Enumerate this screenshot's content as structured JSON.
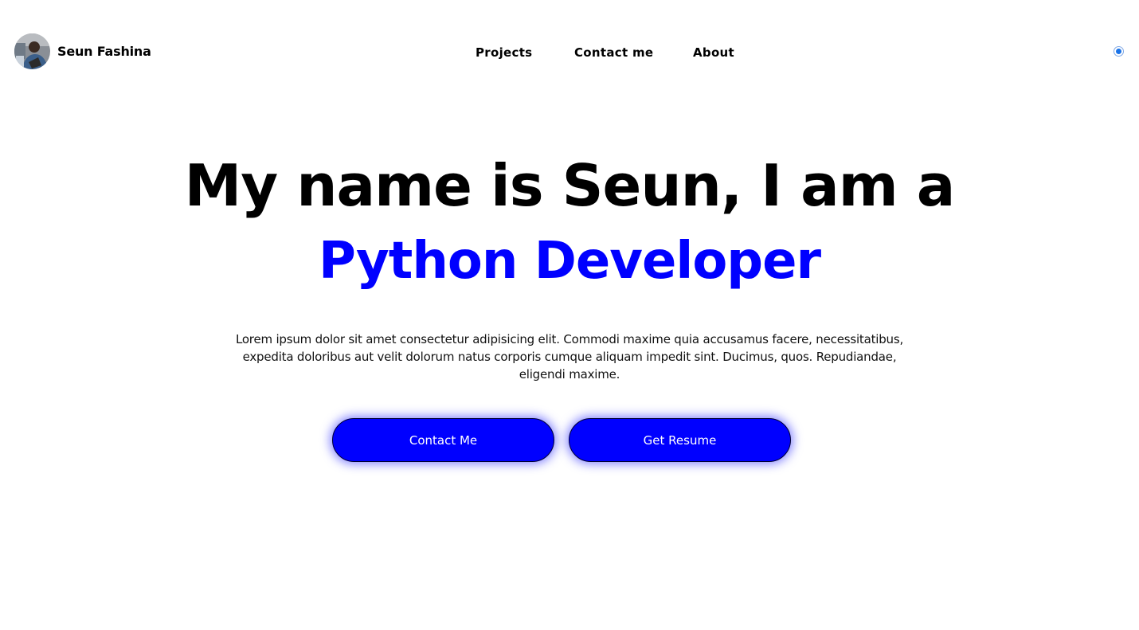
{
  "brand": {
    "name": "Seun Fashina"
  },
  "nav": {
    "items": [
      {
        "label": "Projects"
      },
      {
        "label": "Contact me"
      },
      {
        "label": "About"
      }
    ]
  },
  "hero": {
    "title": "My name is Seun, I am a",
    "subtitle": "Python Developer",
    "description": "Lorem ipsum dolor sit amet consectetur adipisicing elit. Commodi maxime quia accusamus facere, necessitatibus, expedita doloribus aut velit dolorum natus corporis cumque aliquam impedit sint. Ducimus, quos. Repudiandae, eligendi maxime.",
    "buttons": {
      "contact_label": "Contact Me",
      "resume_label": "Get Resume"
    }
  },
  "colors": {
    "accent": "#0000ff",
    "toggle": "#1a73e8"
  },
  "icons": {
    "avatar": "profile-photo",
    "theme_toggle": "radio-toggle"
  }
}
